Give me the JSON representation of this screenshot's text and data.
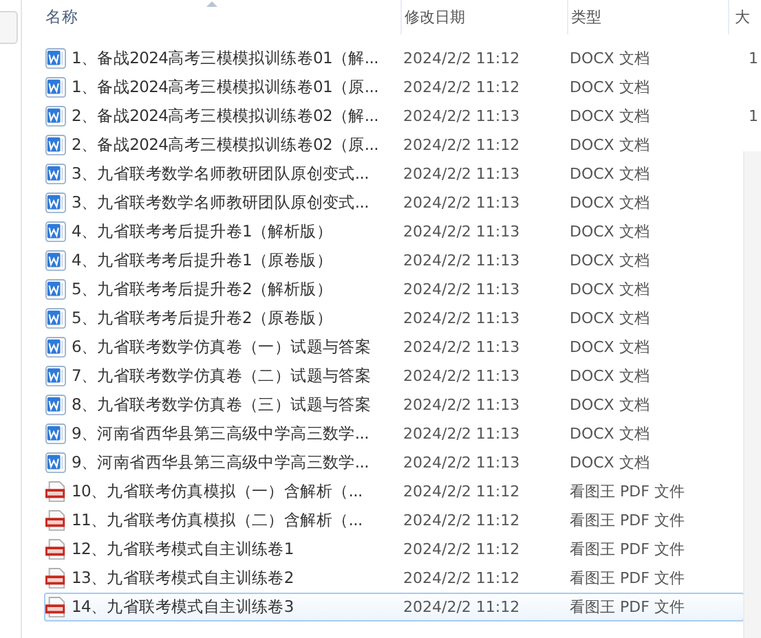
{
  "columns": [
    {
      "label": "名称",
      "sorted": true
    },
    {
      "label": "修改日期",
      "sorted": false
    },
    {
      "label": "类型",
      "sorted": false
    },
    {
      "label": "大",
      "sorted": false
    }
  ],
  "rows": [
    {
      "kind": "docx",
      "name": "1、备战2024高考三模模拟训练卷01（解...",
      "date": "2024/2/2 11:12",
      "type": "DOCX 文档",
      "size": "1",
      "selected": false
    },
    {
      "kind": "docx",
      "name": "1、备战2024高考三模模拟训练卷01（原...",
      "date": "2024/2/2 11:12",
      "type": "DOCX 文档",
      "selected": false
    },
    {
      "kind": "docx",
      "name": "2、备战2024高考三模模拟训练卷02（解...",
      "date": "2024/2/2 11:13",
      "type": "DOCX 文档",
      "size": "1",
      "selected": false
    },
    {
      "kind": "docx",
      "name": "2、备战2024高考三模模拟训练卷02（原...",
      "date": "2024/2/2 11:12",
      "type": "DOCX 文档",
      "selected": false
    },
    {
      "kind": "docx",
      "name": "3、九省联考数学名师教研团队原创变式...",
      "date": "2024/2/2 11:13",
      "type": "DOCX 文档",
      "selected": false
    },
    {
      "kind": "docx",
      "name": "3、九省联考数学名师教研团队原创变式...",
      "date": "2024/2/2 11:13",
      "type": "DOCX 文档",
      "selected": false
    },
    {
      "kind": "docx",
      "name": "4、九省联考考后提升卷1（解析版）",
      "date": "2024/2/2 11:13",
      "type": "DOCX 文档",
      "selected": false
    },
    {
      "kind": "docx",
      "name": "4、九省联考考后提升卷1（原卷版）",
      "date": "2024/2/2 11:13",
      "type": "DOCX 文档",
      "selected": false
    },
    {
      "kind": "docx",
      "name": "5、九省联考考后提升卷2（解析版）",
      "date": "2024/2/2 11:13",
      "type": "DOCX 文档",
      "selected": false
    },
    {
      "kind": "docx",
      "name": "5、九省联考考后提升卷2（原卷版）",
      "date": "2024/2/2 11:13",
      "type": "DOCX 文档",
      "selected": false
    },
    {
      "kind": "docx",
      "name": "6、九省联考数学仿真卷（一）试题与答案",
      "date": "2024/2/2 11:13",
      "type": "DOCX 文档",
      "selected": false
    },
    {
      "kind": "docx",
      "name": "7、九省联考数学仿真卷（二）试题与答案",
      "date": "2024/2/2 11:13",
      "type": "DOCX 文档",
      "selected": false
    },
    {
      "kind": "docx",
      "name": "8、九省联考数学仿真卷（三）试题与答案",
      "date": "2024/2/2 11:13",
      "type": "DOCX 文档",
      "selected": false
    },
    {
      "kind": "docx",
      "name": "9、河南省西华县第三高级中学高三数学...",
      "date": "2024/2/2 11:13",
      "type": "DOCX 文档",
      "selected": false
    },
    {
      "kind": "docx",
      "name": "9、河南省西华县第三高级中学高三数学...",
      "date": "2024/2/2 11:13",
      "type": "DOCX 文档",
      "selected": false
    },
    {
      "kind": "pdf",
      "name": "10、九省联考仿真模拟（一）含解析（...",
      "date": "2024/2/2 11:12",
      "type": "看图王 PDF 文件",
      "selected": false
    },
    {
      "kind": "pdf",
      "name": "11、九省联考仿真模拟（二）含解析（...",
      "date": "2024/2/2 11:12",
      "type": "看图王 PDF 文件",
      "selected": false
    },
    {
      "kind": "pdf",
      "name": "12、九省联考模式自主训练卷1",
      "date": "2024/2/2 11:12",
      "type": "看图王 PDF 文件",
      "selected": false
    },
    {
      "kind": "pdf",
      "name": "13、九省联考模式自主训练卷2",
      "date": "2024/2/2 11:12",
      "type": "看图王 PDF 文件",
      "selected": false
    },
    {
      "kind": "pdf",
      "name": "14、九省联考模式自主训练卷3",
      "date": "2024/2/2 11:12",
      "type": "看图王 PDF 文件",
      "selected": true
    }
  ]
}
